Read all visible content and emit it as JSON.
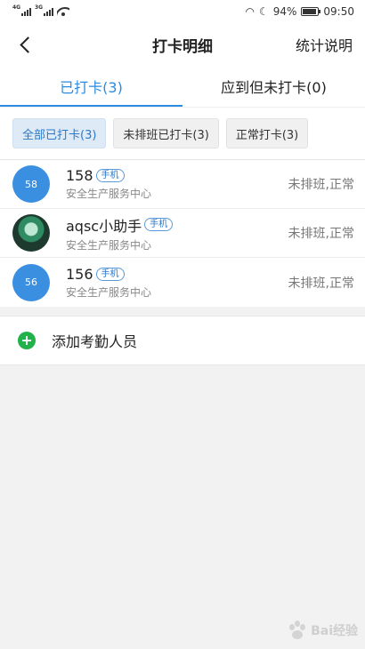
{
  "statusbar": {
    "net1": "4G",
    "net2": "3G",
    "battery_pct": "94%",
    "time": "09:50"
  },
  "nav": {
    "title": "打卡明细",
    "right": "统计说明"
  },
  "tabs": [
    {
      "label": "已打卡(3)",
      "active": true
    },
    {
      "label": "应到但未打卡(0)",
      "active": false
    }
  ],
  "filters": [
    {
      "label": "全部已打卡(3)",
      "active": true
    },
    {
      "label": "未排班已打卡(3)",
      "active": false
    },
    {
      "label": "正常打卡(3)",
      "active": false
    }
  ],
  "people": [
    {
      "avatar": "58",
      "name": "158",
      "tag": "手机",
      "dept": "安全生产服务中心",
      "status": "未排班,正常"
    },
    {
      "avatar": "",
      "name": "aqsc小助手",
      "tag": "手机",
      "dept": "安全生产服务中心",
      "status": "未排班,正常"
    },
    {
      "avatar": "56",
      "name": "156",
      "tag": "手机",
      "dept": "安全生产服务中心",
      "status": "未排班,正常"
    }
  ],
  "add": {
    "label": "添加考勤人员"
  },
  "watermark": {
    "text": "Bai经验"
  }
}
